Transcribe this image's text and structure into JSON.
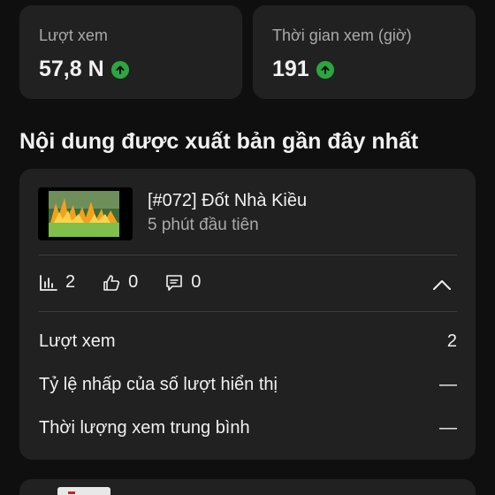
{
  "stats": {
    "views": {
      "label": "Lượt xem",
      "value": "57,8 N"
    },
    "watch_time": {
      "label": "Thời gian xem (giờ)",
      "value": "191"
    }
  },
  "section_title": "Nội dung được xuất bản gần đây nhất",
  "video": {
    "title": "[#072] Đốt Nhà Kiều",
    "subtitle": "5 phút đầu tiên",
    "metrics": {
      "views": "2",
      "likes": "0",
      "comments": "0"
    },
    "details": [
      {
        "label": "Lượt xem",
        "value": "2"
      },
      {
        "label": "Tỷ lệ nhấp của số lượt hiển thị",
        "value": "—"
      },
      {
        "label": "Thời lượng xem trung bình",
        "value": "—"
      }
    ]
  },
  "colors": {
    "up_indicator": "#2ba640",
    "card": "#212121",
    "background": "#0f0f0f"
  }
}
